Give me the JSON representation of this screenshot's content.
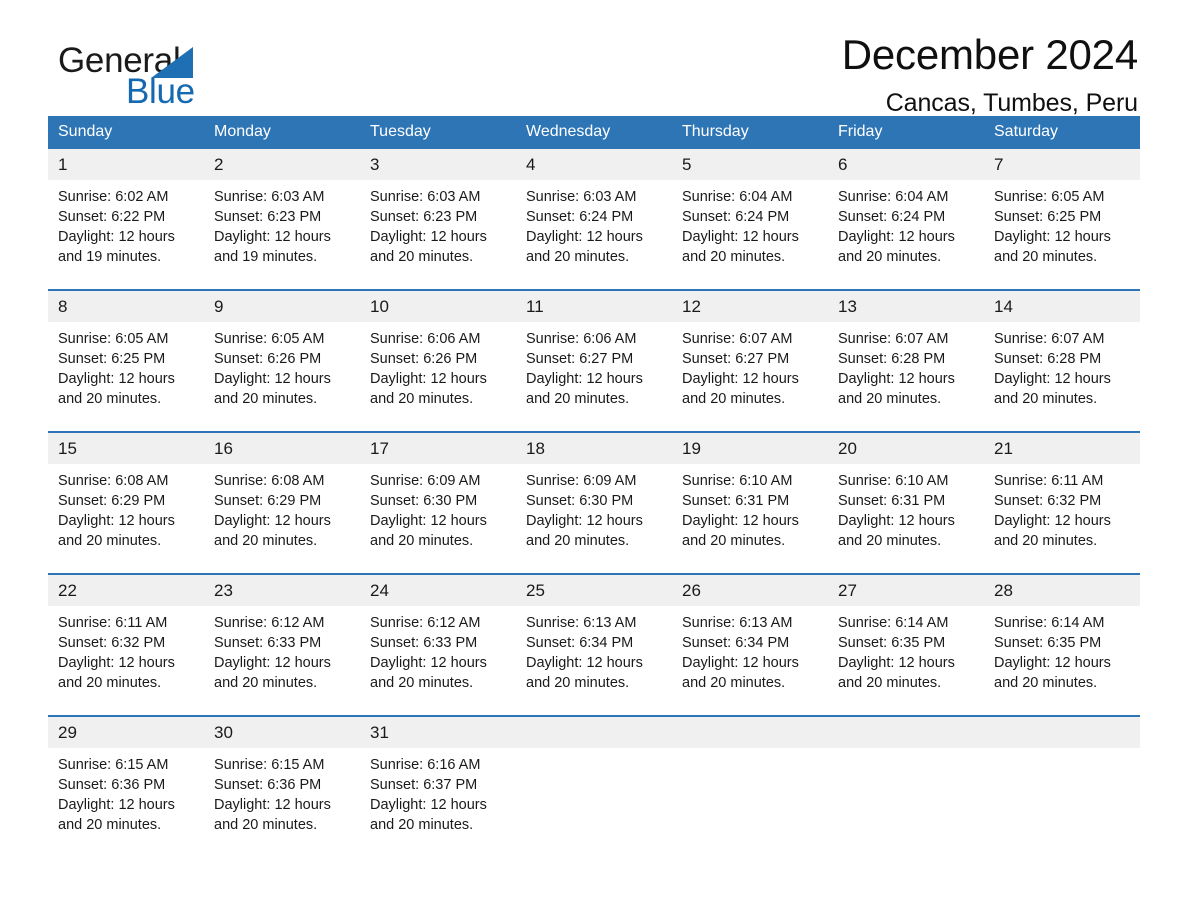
{
  "brand": {
    "name_part1": "General",
    "name_part2": "Blue",
    "triangle_color": "#1f6fb5",
    "blue_color": "#1569b0"
  },
  "header": {
    "month_title": "December 2024",
    "location": "Cancas, Tumbes, Peru"
  },
  "theme": {
    "header_bg": "#2e75b6",
    "daynum_bg": "#f0f0f0",
    "separator": "#2e75b6",
    "text": "#1a1a1a"
  },
  "weekdays": [
    "Sunday",
    "Monday",
    "Tuesday",
    "Wednesday",
    "Thursday",
    "Friday",
    "Saturday"
  ],
  "weeks": [
    {
      "days": [
        {
          "num": "1",
          "sunrise": "Sunrise: 6:02 AM",
          "sunset": "Sunset: 6:22 PM",
          "daylight1": "Daylight: 12 hours",
          "daylight2": "and 19 minutes."
        },
        {
          "num": "2",
          "sunrise": "Sunrise: 6:03 AM",
          "sunset": "Sunset: 6:23 PM",
          "daylight1": "Daylight: 12 hours",
          "daylight2": "and 19 minutes."
        },
        {
          "num": "3",
          "sunrise": "Sunrise: 6:03 AM",
          "sunset": "Sunset: 6:23 PM",
          "daylight1": "Daylight: 12 hours",
          "daylight2": "and 20 minutes."
        },
        {
          "num": "4",
          "sunrise": "Sunrise: 6:03 AM",
          "sunset": "Sunset: 6:24 PM",
          "daylight1": "Daylight: 12 hours",
          "daylight2": "and 20 minutes."
        },
        {
          "num": "5",
          "sunrise": "Sunrise: 6:04 AM",
          "sunset": "Sunset: 6:24 PM",
          "daylight1": "Daylight: 12 hours",
          "daylight2": "and 20 minutes."
        },
        {
          "num": "6",
          "sunrise": "Sunrise: 6:04 AM",
          "sunset": "Sunset: 6:24 PM",
          "daylight1": "Daylight: 12 hours",
          "daylight2": "and 20 minutes."
        },
        {
          "num": "7",
          "sunrise": "Sunrise: 6:05 AM",
          "sunset": "Sunset: 6:25 PM",
          "daylight1": "Daylight: 12 hours",
          "daylight2": "and 20 minutes."
        }
      ]
    },
    {
      "days": [
        {
          "num": "8",
          "sunrise": "Sunrise: 6:05 AM",
          "sunset": "Sunset: 6:25 PM",
          "daylight1": "Daylight: 12 hours",
          "daylight2": "and 20 minutes."
        },
        {
          "num": "9",
          "sunrise": "Sunrise: 6:05 AM",
          "sunset": "Sunset: 6:26 PM",
          "daylight1": "Daylight: 12 hours",
          "daylight2": "and 20 minutes."
        },
        {
          "num": "10",
          "sunrise": "Sunrise: 6:06 AM",
          "sunset": "Sunset: 6:26 PM",
          "daylight1": "Daylight: 12 hours",
          "daylight2": "and 20 minutes."
        },
        {
          "num": "11",
          "sunrise": "Sunrise: 6:06 AM",
          "sunset": "Sunset: 6:27 PM",
          "daylight1": "Daylight: 12 hours",
          "daylight2": "and 20 minutes."
        },
        {
          "num": "12",
          "sunrise": "Sunrise: 6:07 AM",
          "sunset": "Sunset: 6:27 PM",
          "daylight1": "Daylight: 12 hours",
          "daylight2": "and 20 minutes."
        },
        {
          "num": "13",
          "sunrise": "Sunrise: 6:07 AM",
          "sunset": "Sunset: 6:28 PM",
          "daylight1": "Daylight: 12 hours",
          "daylight2": "and 20 minutes."
        },
        {
          "num": "14",
          "sunrise": "Sunrise: 6:07 AM",
          "sunset": "Sunset: 6:28 PM",
          "daylight1": "Daylight: 12 hours",
          "daylight2": "and 20 minutes."
        }
      ]
    },
    {
      "days": [
        {
          "num": "15",
          "sunrise": "Sunrise: 6:08 AM",
          "sunset": "Sunset: 6:29 PM",
          "daylight1": "Daylight: 12 hours",
          "daylight2": "and 20 minutes."
        },
        {
          "num": "16",
          "sunrise": "Sunrise: 6:08 AM",
          "sunset": "Sunset: 6:29 PM",
          "daylight1": "Daylight: 12 hours",
          "daylight2": "and 20 minutes."
        },
        {
          "num": "17",
          "sunrise": "Sunrise: 6:09 AM",
          "sunset": "Sunset: 6:30 PM",
          "daylight1": "Daylight: 12 hours",
          "daylight2": "and 20 minutes."
        },
        {
          "num": "18",
          "sunrise": "Sunrise: 6:09 AM",
          "sunset": "Sunset: 6:30 PM",
          "daylight1": "Daylight: 12 hours",
          "daylight2": "and 20 minutes."
        },
        {
          "num": "19",
          "sunrise": "Sunrise: 6:10 AM",
          "sunset": "Sunset: 6:31 PM",
          "daylight1": "Daylight: 12 hours",
          "daylight2": "and 20 minutes."
        },
        {
          "num": "20",
          "sunrise": "Sunrise: 6:10 AM",
          "sunset": "Sunset: 6:31 PM",
          "daylight1": "Daylight: 12 hours",
          "daylight2": "and 20 minutes."
        },
        {
          "num": "21",
          "sunrise": "Sunrise: 6:11 AM",
          "sunset": "Sunset: 6:32 PM",
          "daylight1": "Daylight: 12 hours",
          "daylight2": "and 20 minutes."
        }
      ]
    },
    {
      "days": [
        {
          "num": "22",
          "sunrise": "Sunrise: 6:11 AM",
          "sunset": "Sunset: 6:32 PM",
          "daylight1": "Daylight: 12 hours",
          "daylight2": "and 20 minutes."
        },
        {
          "num": "23",
          "sunrise": "Sunrise: 6:12 AM",
          "sunset": "Sunset: 6:33 PM",
          "daylight1": "Daylight: 12 hours",
          "daylight2": "and 20 minutes."
        },
        {
          "num": "24",
          "sunrise": "Sunrise: 6:12 AM",
          "sunset": "Sunset: 6:33 PM",
          "daylight1": "Daylight: 12 hours",
          "daylight2": "and 20 minutes."
        },
        {
          "num": "25",
          "sunrise": "Sunrise: 6:13 AM",
          "sunset": "Sunset: 6:34 PM",
          "daylight1": "Daylight: 12 hours",
          "daylight2": "and 20 minutes."
        },
        {
          "num": "26",
          "sunrise": "Sunrise: 6:13 AM",
          "sunset": "Sunset: 6:34 PM",
          "daylight1": "Daylight: 12 hours",
          "daylight2": "and 20 minutes."
        },
        {
          "num": "27",
          "sunrise": "Sunrise: 6:14 AM",
          "sunset": "Sunset: 6:35 PM",
          "daylight1": "Daylight: 12 hours",
          "daylight2": "and 20 minutes."
        },
        {
          "num": "28",
          "sunrise": "Sunrise: 6:14 AM",
          "sunset": "Sunset: 6:35 PM",
          "daylight1": "Daylight: 12 hours",
          "daylight2": "and 20 minutes."
        }
      ]
    },
    {
      "days": [
        {
          "num": "29",
          "sunrise": "Sunrise: 6:15 AM",
          "sunset": "Sunset: 6:36 PM",
          "daylight1": "Daylight: 12 hours",
          "daylight2": "and 20 minutes."
        },
        {
          "num": "30",
          "sunrise": "Sunrise: 6:15 AM",
          "sunset": "Sunset: 6:36 PM",
          "daylight1": "Daylight: 12 hours",
          "daylight2": "and 20 minutes."
        },
        {
          "num": "31",
          "sunrise": "Sunrise: 6:16 AM",
          "sunset": "Sunset: 6:37 PM",
          "daylight1": "Daylight: 12 hours",
          "daylight2": "and 20 minutes."
        },
        {
          "num": "",
          "sunrise": "",
          "sunset": "",
          "daylight1": "",
          "daylight2": ""
        },
        {
          "num": "",
          "sunrise": "",
          "sunset": "",
          "daylight1": "",
          "daylight2": ""
        },
        {
          "num": "",
          "sunrise": "",
          "sunset": "",
          "daylight1": "",
          "daylight2": ""
        },
        {
          "num": "",
          "sunrise": "",
          "sunset": "",
          "daylight1": "",
          "daylight2": ""
        }
      ]
    }
  ]
}
